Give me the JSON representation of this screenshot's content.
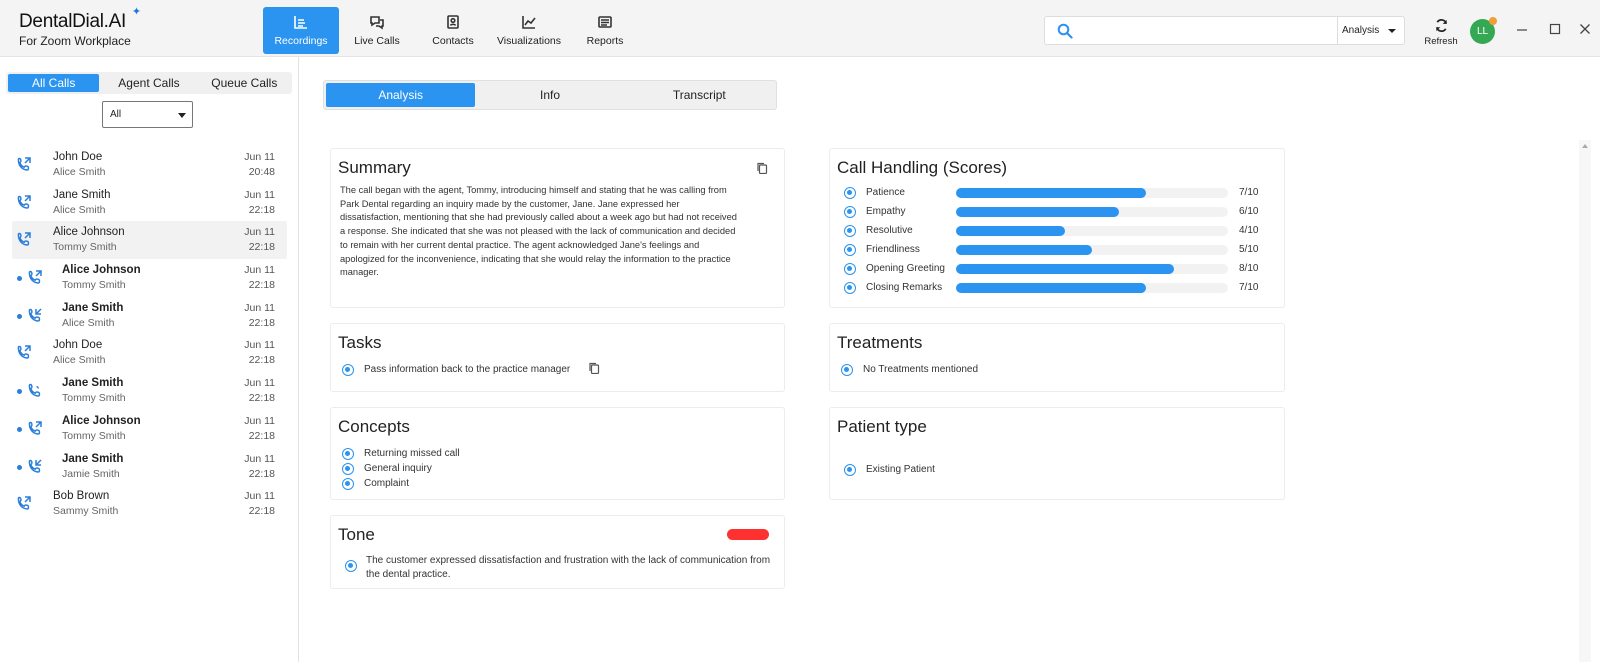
{
  "app": {
    "title": "DentalDial.AI",
    "subtitle": "For Zoom Workplace"
  },
  "nav": [
    {
      "label": "Recordings",
      "icon": "recordings-icon",
      "active": true
    },
    {
      "label": "Live Calls",
      "icon": "live-calls-icon",
      "active": false
    },
    {
      "label": "Contacts",
      "icon": "contacts-icon",
      "active": false
    },
    {
      "label": "Visualizations",
      "icon": "visualizations-icon",
      "active": false
    },
    {
      "label": "Reports",
      "icon": "reports-icon",
      "active": false
    }
  ],
  "search": {
    "value": "",
    "placeholder": "",
    "scope": "Analysis"
  },
  "header": {
    "refresh_label": "Refresh",
    "avatar_initials": "LL"
  },
  "left": {
    "tabs": [
      "All Calls",
      "Agent Calls",
      "Queue Calls"
    ],
    "active_tab": "All Calls",
    "filter": "All",
    "calls": [
      {
        "name": "John Doe",
        "agent": "Alice Smith",
        "date": "Jun 11",
        "time": "20:48",
        "unread": false,
        "direction": "outgoing"
      },
      {
        "name": "Jane Smith",
        "agent": "Alice Smith",
        "date": "Jun 11",
        "time": "22:18",
        "unread": false,
        "direction": "outgoing"
      },
      {
        "name": "Alice Johnson",
        "agent": "Tommy Smith",
        "date": "Jun 11",
        "time": "22:18",
        "unread": false,
        "direction": "outgoing",
        "selected": true
      },
      {
        "name": "Alice Johnson",
        "agent": "Tommy Smith",
        "date": "Jun 11",
        "time": "22:18",
        "unread": true,
        "direction": "outgoing"
      },
      {
        "name": "Jane Smith",
        "agent": "Alice Smith",
        "date": "Jun 11",
        "time": "22:18",
        "unread": true,
        "direction": "incoming"
      },
      {
        "name": "John Doe",
        "agent": "Alice Smith",
        "date": "Jun 11",
        "time": "22:18",
        "unread": false,
        "direction": "outgoing"
      },
      {
        "name": "Jane Smith",
        "agent": "Tommy Smith",
        "date": "Jun 11",
        "time": "22:18",
        "unread": true,
        "direction": "phone"
      },
      {
        "name": "Alice Johnson",
        "agent": "Tommy Smith",
        "date": "Jun 11",
        "time": "22:18",
        "unread": true,
        "direction": "outgoing"
      },
      {
        "name": "Jane Smith",
        "agent": "Jamie Smith",
        "date": "Jun 11",
        "time": "22:18",
        "unread": true,
        "direction": "incoming"
      },
      {
        "name": "Bob Brown",
        "agent": "Sammy Smith",
        "date": "Jun 11",
        "time": "22:18",
        "unread": false,
        "direction": "outgoing"
      }
    ]
  },
  "detail": {
    "tabs": [
      "Analysis",
      "Info",
      "Transcript"
    ],
    "active_tab": "Analysis",
    "summary": {
      "title": "Summary",
      "text": "The call began with the agent, Tommy, introducing himself and stating that he was calling from Park Dental regarding an inquiry made by the customer, Jane. Jane expressed her dissatisfaction, mentioning that she had previously called about a week ago but had not received a response. She indicated that she was not pleased with the lack of communication and decided to remain with her current dental practice. The agent acknowledged Jane's feelings and apologized for the inconvenience, indicating that she would relay the information to the practice manager."
    },
    "scores": {
      "title": "Call Handling (Scores)",
      "items": [
        {
          "label": "Patience",
          "value": 7,
          "display": "7/10"
        },
        {
          "label": "Empathy",
          "value": 6,
          "display": "6/10"
        },
        {
          "label": "Resolutive",
          "value": 4,
          "display": "4/10"
        },
        {
          "label": "Friendliness",
          "value": 5,
          "display": "5/10"
        },
        {
          "label": "Opening Greeting",
          "value": 8,
          "display": "8/10"
        },
        {
          "label": "Closing Remarks",
          "value": 7,
          "display": "7/10"
        }
      ],
      "max": 10,
      "bar_color": "#2b93f0"
    },
    "tasks": {
      "title": "Tasks",
      "items": [
        "Pass information back to the practice manager"
      ]
    },
    "treatments": {
      "title": "Treatments",
      "items": [
        "No Treatments mentioned"
      ]
    },
    "concepts": {
      "title": "Concepts",
      "items": [
        "Returning missed call",
        "General inquiry",
        "Complaint"
      ]
    },
    "patient_type": {
      "title": "Patient type",
      "items": [
        "Existing Patient"
      ]
    },
    "tone": {
      "title": "Tone",
      "indicator_color": "#ff3030",
      "text": "The customer expressed dissatisfaction and frustration with the lack of communication from the dental practice."
    }
  },
  "colors": {
    "accent": "#2b93f0",
    "avatar": "#34a853",
    "notification": "#f29d38"
  }
}
